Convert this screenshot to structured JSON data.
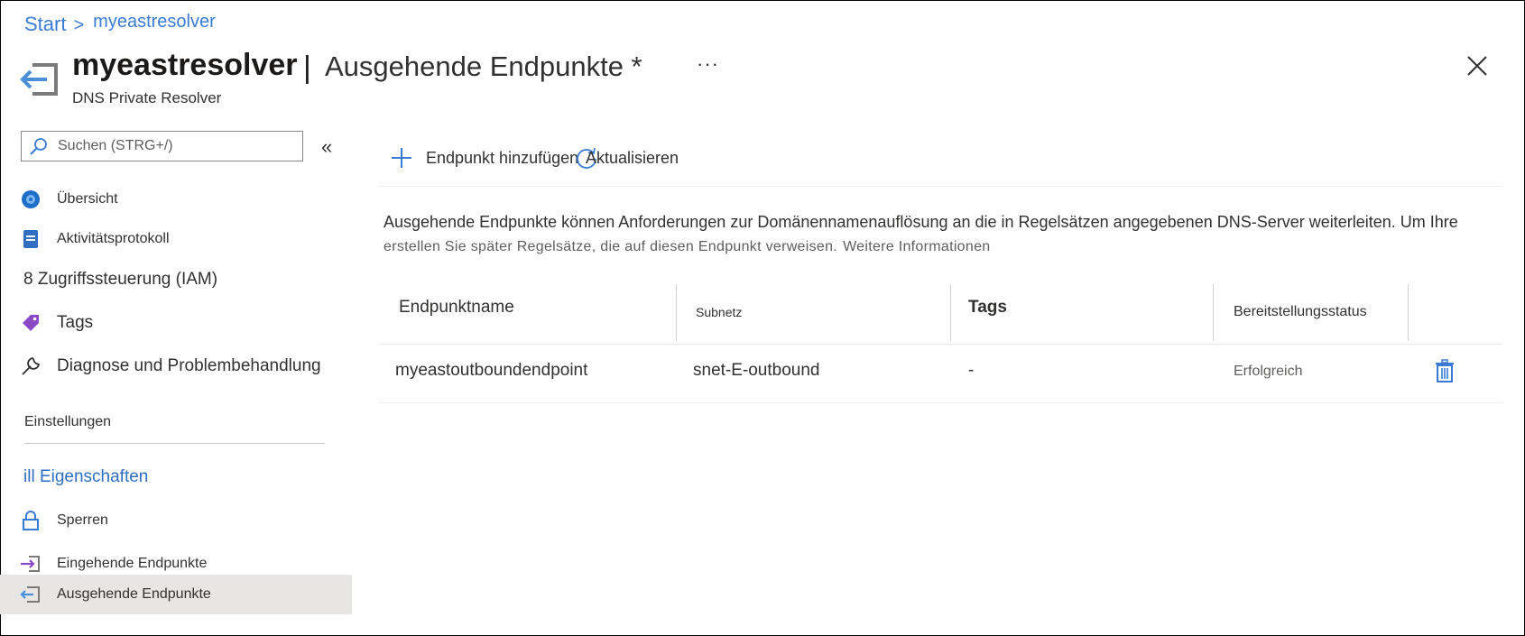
{
  "breadcrumb": {
    "root": "Start",
    "separator": ">",
    "current": "myeastresolver"
  },
  "header": {
    "resource_name": "myeastresolver",
    "title_separator": "|",
    "page_title": "Ausgehende Endpunkte *",
    "more_label": "···",
    "resource_type": "DNS Private Resolver",
    "icon": "outbound-endpoint-icon",
    "close_icon": "close-icon"
  },
  "sidebar": {
    "search_placeholder": "Suchen (STRG+/)",
    "collapse_label": "«",
    "items": [
      {
        "label": "Übersicht",
        "icon": "overview-globe-icon"
      },
      {
        "label": "Aktivitätsprotokoll",
        "icon": "activity-log-icon"
      },
      {
        "label": "8 Zugriffssteuerung (IAM)",
        "icon": ""
      },
      {
        "label": "Tags",
        "icon": "tag-icon"
      },
      {
        "label": "Diagnose und Problembehandlung",
        "icon": "wrench-icon"
      }
    ],
    "section_settings": "Einstellungen",
    "settings_items": [
      {
        "label": "ill Eigenschaften",
        "icon": ""
      },
      {
        "label": "Sperren",
        "icon": "lock-icon"
      },
      {
        "label": "Eingehende Endpunkte",
        "icon": "inbound-endpoint-icon"
      },
      {
        "label": "Ausgehende Endpunkte",
        "icon": "outbound-endpoint-icon",
        "selected": true
      }
    ]
  },
  "toolbar": {
    "add_label": "Endpunkt hinzufügen",
    "refresh_label": "Aktualisieren"
  },
  "description": {
    "line1": "Ausgehende Endpunkte können Anforderungen zur Domänennamenauflösung an die in Regelsätzen angegebenen DNS-Server weiterleiten. Um Ihre",
    "line2": "erstellen Sie später Regelsätze, die auf diesen Endpunkt verweisen.",
    "more": "Weitere Informationen"
  },
  "table": {
    "columns": [
      "Endpunktname",
      "Subnetz",
      "Tags",
      "Bereitstellungsstatus"
    ],
    "rows": [
      {
        "name": "myeastoutboundendpoint",
        "subnet": "snet-E-outbound",
        "tags": "-",
        "status": "Erfolgreich",
        "delete_icon": "trash-icon"
      }
    ]
  },
  "colors": {
    "accent": "#0a64c8",
    "selected_bg": "#e7e6e5",
    "breadcrumb": "#3a7bd5"
  }
}
